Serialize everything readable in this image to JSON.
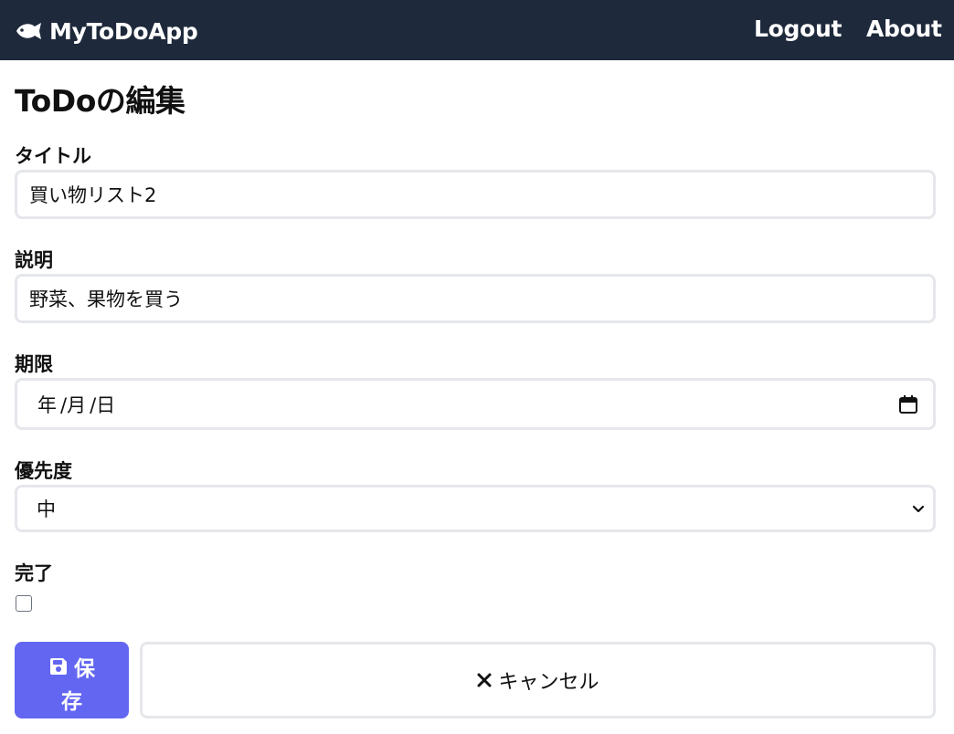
{
  "navbar": {
    "brand": "MyToDoApp",
    "brand_icon": "fish-icon",
    "links": [
      "Logout",
      "About"
    ],
    "background": "#1e293b"
  },
  "page": {
    "title": "ToDoの編集"
  },
  "form": {
    "title": {
      "label": "タイトル",
      "value": "買い物リスト2"
    },
    "description": {
      "label": "説明",
      "value": "野菜、果物を買う"
    },
    "due": {
      "label": "期限",
      "year": "年",
      "month": "/月",
      "day": "/日",
      "icon": "calendar-icon"
    },
    "priority": {
      "label": "優先度",
      "selected": "中",
      "icon": "chevron-down-icon"
    },
    "done": {
      "label": "完了",
      "checked": false
    }
  },
  "actions": {
    "save": {
      "label_line1": "保",
      "label_line2": "存",
      "icon": "save-disk-icon",
      "color": "#6366f1"
    },
    "cancel": {
      "label": "キャンセル",
      "icon": "x-icon"
    }
  }
}
